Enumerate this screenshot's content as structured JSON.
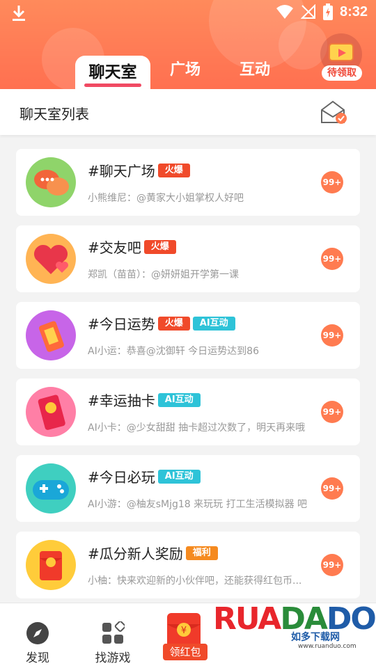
{
  "status_bar": {
    "time": "8:32"
  },
  "header": {
    "tabs": [
      {
        "label": "聊天室",
        "active": true
      },
      {
        "label": "广场",
        "active": false
      },
      {
        "label": "互动",
        "active": false
      }
    ],
    "reward_label": "待领取"
  },
  "list_header": {
    "title": "聊天室列表"
  },
  "rooms": [
    {
      "name": "#聊天广场",
      "tags": [
        "火爆"
      ],
      "message": "小熊维尼：@黄家大小姐掌权人好吧",
      "badge": "99+",
      "icon": "chat-bubbles-icon",
      "color": "#8fd46a"
    },
    {
      "name": "#交友吧",
      "tags": [
        "火爆"
      ],
      "message": "郑凯（苗苗）：@妍妍姐开学第一课",
      "badge": "99+",
      "icon": "hearts-icon",
      "color": "#ffb454"
    },
    {
      "name": "#今日运势",
      "tags": [
        "火爆",
        "AI互动"
      ],
      "message": "AI小运：恭喜@沈御轩 今日运势达到86",
      "badge": "99+",
      "icon": "fortune-tag-icon",
      "color": "#c765e8"
    },
    {
      "name": "#幸运抽卡",
      "tags": [
        "AI互动"
      ],
      "message": "AI小卡：@少女甜甜 抽卡超过次数了，明天再来哦",
      "badge": "99+",
      "icon": "lucky-card-icon",
      "color": "#ff7fa6"
    },
    {
      "name": "#今日必玩",
      "tags": [
        "AI互动"
      ],
      "message": "AI小游：@柚友sMjg18 来玩玩 打工生活模拟器 吧",
      "badge": "99+",
      "icon": "gamepad-icon",
      "color": "#3fcfc0"
    },
    {
      "name": "#瓜分新人奖励",
      "tags": [
        "福利"
      ],
      "message": "小柚：快来欢迎新的小伙伴吧，还能获得红包币...",
      "badge": "99+",
      "icon": "red-envelope-icon",
      "color": "#ffcc3a"
    }
  ],
  "tag_styles": {
    "火爆": "hot",
    "AI互动": "ai",
    "福利": "fuli"
  },
  "bottom_nav": [
    {
      "label": "发现",
      "icon": "compass-icon"
    },
    {
      "label": "找游戏",
      "icon": "game-grid-icon"
    },
    {
      "label": "领红包",
      "icon": "red-envelope-icon"
    }
  ],
  "watermark": {
    "brand": "RUANDADO",
    "subtitle": "如多下载网",
    "url": "www.ruanduo.com"
  }
}
